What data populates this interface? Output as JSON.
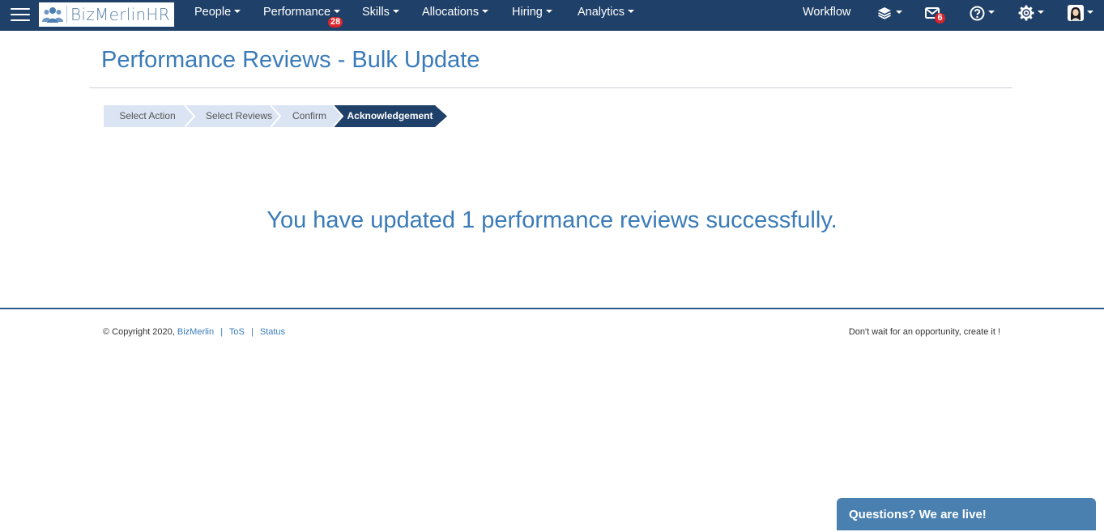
{
  "nav": {
    "brand": "BizMerlinHR",
    "items": [
      {
        "label": "People"
      },
      {
        "label": "Performance",
        "badge": "28"
      },
      {
        "label": "Skills"
      },
      {
        "label": "Allocations"
      },
      {
        "label": "Hiring"
      },
      {
        "label": "Analytics"
      }
    ],
    "workflow_label": "Workflow",
    "icons": [
      "menu-icon",
      "layers-icon",
      "mail-icon",
      "help-icon",
      "gear-icon",
      "avatar"
    ],
    "mail_badge": "6"
  },
  "page": {
    "title": "Performance Reviews - Bulk Update"
  },
  "wizard": {
    "steps": [
      {
        "label": "Select Action",
        "state": "done"
      },
      {
        "label": "Select Reviews",
        "state": "done"
      },
      {
        "label": "Confirm",
        "state": "done"
      },
      {
        "label": "Acknowledgement",
        "state": "active"
      }
    ]
  },
  "message": "You have updated 1 performance reviews successfully.",
  "footer": {
    "copyright": "© Copyright 2020,",
    "company_link": "BizMerlin",
    "tos_link": "ToS",
    "status_link": "Status",
    "separator": "|",
    "tagline": "Don't wait for an opportunity, create it !"
  },
  "chat": {
    "label": "Questions? We are live!"
  },
  "colors": {
    "nav_bg": "#1f4068",
    "accent": "#3a7bb8",
    "step_done": "#dae4f3",
    "step_active": "#1f4068",
    "badge": "#d9262c",
    "chat_bg": "#4a80b0"
  }
}
